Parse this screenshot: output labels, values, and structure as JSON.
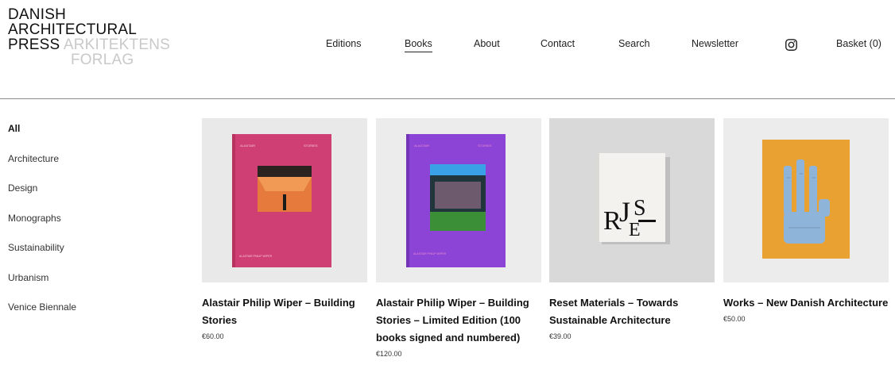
{
  "logo": {
    "line1": "DANISH",
    "line2": "ARCHITECTURAL",
    "line3_black": "PRESS",
    "line3_grey": "ARKITEKTENS",
    "line4_grey": "FORLAG"
  },
  "nav": {
    "items": [
      "Editions",
      "Books",
      "About",
      "Contact",
      "Search",
      "Newsletter"
    ],
    "active": "Books",
    "instagram_icon": "instagram-icon",
    "basket": "Basket (0)"
  },
  "categories": [
    "All",
    "Architecture",
    "Design",
    "Monographs",
    "Sustainability",
    "Urbanism",
    "Venice Biennale"
  ],
  "active_category": "All",
  "products": [
    {
      "title": "Alastair Philip Wiper – Building Stories",
      "price": "€60.00",
      "cover_color": "#d9447c",
      "image_bg": "#e9e9e9"
    },
    {
      "title": "Alastair Philip Wiper – Building Stories – Limited Edition (100 books signed and numbered)",
      "price": "€120.00",
      "cover_color": "#8a3fd3",
      "image_bg": "#ececec"
    },
    {
      "title": "Reset Materials – Towards Sustainable Architecture",
      "price": "€39.00",
      "cover_color": "#f2f1ee",
      "image_bg": "#d9d9d9"
    },
    {
      "title": "Works – New Danish Architecture",
      "price": "€50.00",
      "cover_color": "#e9a232",
      "image_bg": "#ececec"
    }
  ]
}
